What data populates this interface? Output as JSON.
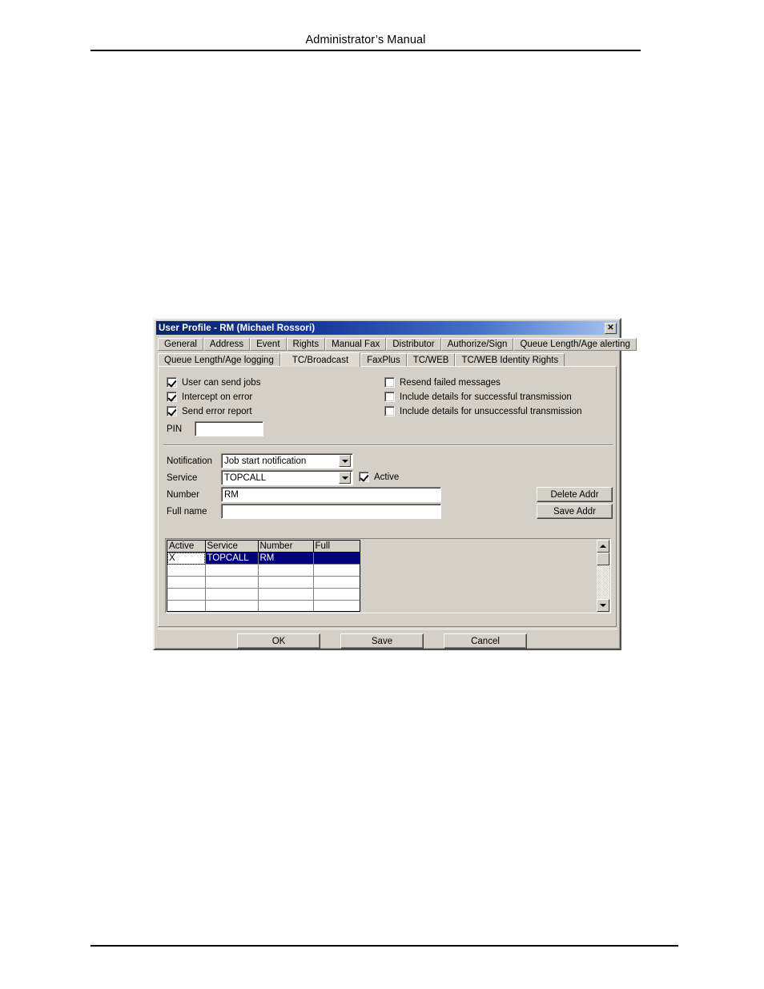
{
  "page": {
    "header_title": "Administrator’s Manual"
  },
  "dialog": {
    "title": "User Profile - RM (Michael Rossori)",
    "close_label": "✕",
    "tabs_row1": [
      {
        "label": "General",
        "selected": false
      },
      {
        "label": "Address",
        "selected": false
      },
      {
        "label": "Event",
        "selected": false
      },
      {
        "label": "Rights",
        "selected": false
      },
      {
        "label": "Manual Fax",
        "selected": false
      },
      {
        "label": "Distributor",
        "selected": false
      },
      {
        "label": "Authorize/Sign",
        "selected": false
      },
      {
        "label": "Queue Length/Age alerting",
        "selected": false
      }
    ],
    "tabs_row2": [
      {
        "label": "Queue Length/Age logging",
        "selected": false
      },
      {
        "label": "TC/Broadcast",
        "selected": true
      },
      {
        "label": "FaxPlus",
        "selected": false
      },
      {
        "label": "TC/WEB",
        "selected": false
      },
      {
        "label": "TC/WEB Identity Rights",
        "selected": false
      }
    ],
    "options_left": [
      {
        "label": "User can send jobs",
        "checked": true
      },
      {
        "label": "Intercept on error",
        "checked": true
      },
      {
        "label": "Send error report",
        "checked": true
      }
    ],
    "options_right": [
      {
        "label": "Resend failed messages",
        "checked": false
      },
      {
        "label": "Include details for successful transmission",
        "checked": false
      },
      {
        "label": "Include details for unsuccessful transmission",
        "checked": false
      }
    ],
    "pin": {
      "label": "PIN",
      "value": "",
      "placeholder": ""
    },
    "notification": {
      "label": "Notification",
      "value": "Job start notification"
    },
    "service": {
      "label": "Service",
      "value": "TOPCALL"
    },
    "active": {
      "label": "Active",
      "checked": true
    },
    "number": {
      "label": "Number",
      "value": "RM",
      "placeholder": ""
    },
    "fullname": {
      "label": "Full name",
      "value": "",
      "placeholder": ""
    },
    "addr_buttons": {
      "delete_label": "Delete Addr",
      "save_label": "Save Addr"
    },
    "grid": {
      "columns": [
        "Active",
        "Service",
        "Number",
        "Full"
      ],
      "rows": [
        {
          "cells": [
            "X",
            "TOPCALL",
            "RM",
            ""
          ],
          "selected": true
        },
        {
          "cells": [
            "",
            "",
            "",
            ""
          ],
          "selected": false
        },
        {
          "cells": [
            "",
            "",
            "",
            ""
          ],
          "selected": false
        },
        {
          "cells": [
            "",
            "",
            "",
            ""
          ],
          "selected": false
        },
        {
          "cells": [
            "",
            "",
            "",
            ""
          ],
          "selected": false
        }
      ]
    },
    "buttons": {
      "ok": "OK",
      "save": "Save",
      "cancel": "Cancel"
    },
    "colors": {
      "face": "#d4d0c8",
      "title_start": "#0a246a",
      "title_end": "#a6c5f0",
      "selection": "#000080"
    }
  }
}
